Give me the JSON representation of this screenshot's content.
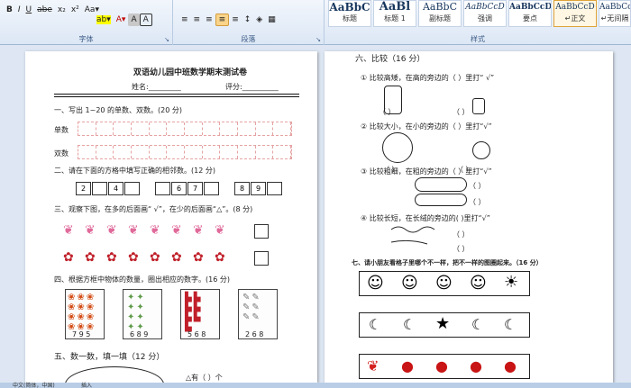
{
  "ribbon": {
    "font_group": "字体",
    "para_group": "段落",
    "styles_group": "样式",
    "font_tools": [
      "x₂",
      "x²",
      "Aa▾",
      "ab▾",
      "A▾",
      "A",
      "A"
    ],
    "styles": [
      {
        "sample": "AaBbC",
        "name": "标题"
      },
      {
        "sample": "AaBl",
        "name": "标题 1"
      },
      {
        "sample": "AaBbC",
        "name": "副标题"
      },
      {
        "sample": "AaBbCcD",
        "name": "强调"
      },
      {
        "sample": "AaBbCcD",
        "name": "要点"
      },
      {
        "sample": "AaBbCcD",
        "name": "↵正文"
      },
      {
        "sample": "AaBbCcD",
        "name": "↵无间隔"
      }
    ]
  },
  "page1": {
    "title": "双语幼儿园中班数学期末测试卷",
    "name_label": "姓名:_________",
    "score_label": "评分:__________",
    "q1": "一、写出 1~20 的单数、双数。(20 分)",
    "odd_label": "单数",
    "even_label": "双数",
    "q2": "二、请在下面的方格中填写正确的相邻数。(12 分)",
    "num_boxes": [
      "2",
      "",
      "4",
      "",
      "",
      "6",
      "7",
      "",
      "8",
      "9",
      ""
    ],
    "q3": "三、观察下图，在多的后面画“ √”，在少的后面画“△”。(8 分)",
    "q4": "四、根据方框中物体的数量，圈出相应的数字。(16 分)",
    "cards": [
      {
        "icon": "flower-icon",
        "nums": "7 9 5"
      },
      {
        "icon": "bird-icon",
        "nums": "6 8 9"
      },
      {
        "icon": "boot-icon",
        "nums": "5 6 8"
      },
      {
        "icon": "pencil-icon",
        "nums": "2 6 8"
      }
    ],
    "q5": "五、数一数，填一填（12 分）",
    "q5_tail": "△有（ ）个"
  },
  "page2": {
    "q6": "六、比较（16 分）",
    "items": [
      "① 比较高矮，在高的旁边的（    ）里打“ √”",
      "② 比较大小，在小的旁边的（    ）里打“√”",
      "③ 比较粗细，在粗的旁边的（    ）里打“√”",
      "④ 比较长短，在长绒的旁边的(    )里打“√”"
    ],
    "paren": "（    ）",
    "q7": "七、请小朋友看格子里哪个不一样，把不一样的图圈起来。（16 分）"
  },
  "status": {
    "lang": "中文(简体，中国)",
    "mode": "插入"
  }
}
